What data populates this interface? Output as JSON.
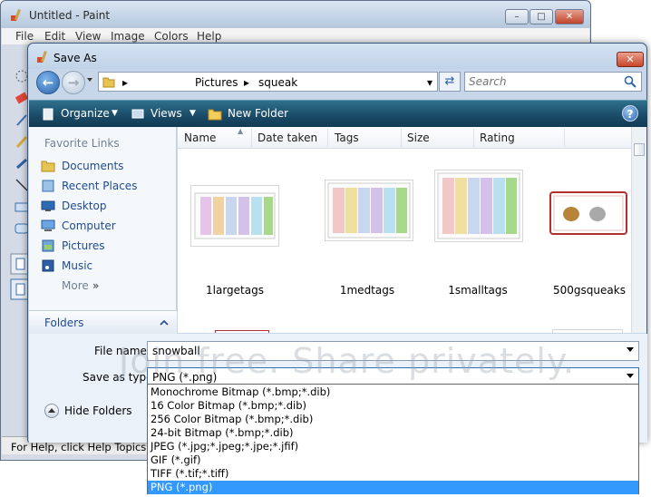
{
  "paint": {
    "title": "Untitled - Paint",
    "menu": [
      "File",
      "Edit",
      "View",
      "Image",
      "Colors",
      "Help"
    ],
    "status": "For Help, click Help Topics o"
  },
  "dialog": {
    "title": "Save As",
    "address": {
      "crumbs": [
        "Pictures",
        "squeak"
      ]
    },
    "search_placeholder": "Search",
    "toolbar": {
      "organize": "Organize",
      "views": "Views",
      "new_folder": "New Folder"
    },
    "nav": {
      "favorites_title": "Favorite Links",
      "items": [
        "Documents",
        "Recent Places",
        "Desktop",
        "Computer",
        "Pictures",
        "Music",
        "More"
      ],
      "folders": "Folders"
    },
    "columns": [
      "Name",
      "Date taken",
      "Tags",
      "Size",
      "Rating"
    ],
    "files": [
      "1largetags",
      "1medtags",
      "1smalltags",
      "500gsqueaks"
    ],
    "file_name_label": "File name:",
    "file_name_value": "snowball",
    "save_type_label": "Save as type:",
    "save_type_value": "PNG (*.png)",
    "hide_folders": "Hide Folders",
    "type_options": [
      "Monochrome Bitmap (*.bmp;*.dib)",
      "16 Color Bitmap (*.bmp;*.dib)",
      "256 Color Bitmap (*.bmp;*.dib)",
      "24-bit Bitmap (*.bmp;*.dib)",
      "JPEG (*.jpg;*.jpeg;*.jpe;*.jfif)",
      "GIF (*.gif)",
      "TIFF (*.tif;*.tiff)",
      "PNG (*.png)"
    ],
    "selected_option_index": 7
  },
  "watermark": "Join free. Share privately.",
  "colors": {
    "selection": "#3399ff",
    "toolbar": "#1a4a66",
    "link": "#1f4a8e"
  }
}
